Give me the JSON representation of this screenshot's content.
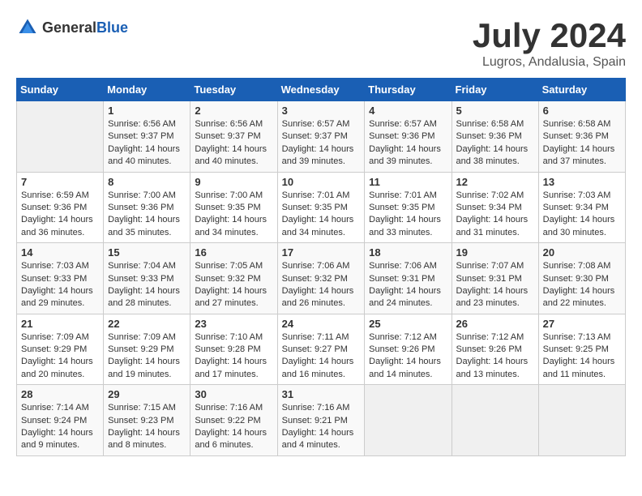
{
  "header": {
    "logo_general": "General",
    "logo_blue": "Blue",
    "month": "July 2024",
    "location": "Lugros, Andalusia, Spain"
  },
  "days_of_week": [
    "Sunday",
    "Monday",
    "Tuesday",
    "Wednesday",
    "Thursday",
    "Friday",
    "Saturday"
  ],
  "weeks": [
    [
      {
        "day": "",
        "empty": true
      },
      {
        "day": "1",
        "sunrise": "Sunrise: 6:56 AM",
        "sunset": "Sunset: 9:37 PM",
        "daylight": "Daylight: 14 hours and 40 minutes."
      },
      {
        "day": "2",
        "sunrise": "Sunrise: 6:56 AM",
        "sunset": "Sunset: 9:37 PM",
        "daylight": "Daylight: 14 hours and 40 minutes."
      },
      {
        "day": "3",
        "sunrise": "Sunrise: 6:57 AM",
        "sunset": "Sunset: 9:37 PM",
        "daylight": "Daylight: 14 hours and 39 minutes."
      },
      {
        "day": "4",
        "sunrise": "Sunrise: 6:57 AM",
        "sunset": "Sunset: 9:36 PM",
        "daylight": "Daylight: 14 hours and 39 minutes."
      },
      {
        "day": "5",
        "sunrise": "Sunrise: 6:58 AM",
        "sunset": "Sunset: 9:36 PM",
        "daylight": "Daylight: 14 hours and 38 minutes."
      },
      {
        "day": "6",
        "sunrise": "Sunrise: 6:58 AM",
        "sunset": "Sunset: 9:36 PM",
        "daylight": "Daylight: 14 hours and 37 minutes."
      }
    ],
    [
      {
        "day": "7",
        "sunrise": "Sunrise: 6:59 AM",
        "sunset": "Sunset: 9:36 PM",
        "daylight": "Daylight: 14 hours and 36 minutes."
      },
      {
        "day": "8",
        "sunrise": "Sunrise: 7:00 AM",
        "sunset": "Sunset: 9:36 PM",
        "daylight": "Daylight: 14 hours and 35 minutes."
      },
      {
        "day": "9",
        "sunrise": "Sunrise: 7:00 AM",
        "sunset": "Sunset: 9:35 PM",
        "daylight": "Daylight: 14 hours and 34 minutes."
      },
      {
        "day": "10",
        "sunrise": "Sunrise: 7:01 AM",
        "sunset": "Sunset: 9:35 PM",
        "daylight": "Daylight: 14 hours and 34 minutes."
      },
      {
        "day": "11",
        "sunrise": "Sunrise: 7:01 AM",
        "sunset": "Sunset: 9:35 PM",
        "daylight": "Daylight: 14 hours and 33 minutes."
      },
      {
        "day": "12",
        "sunrise": "Sunrise: 7:02 AM",
        "sunset": "Sunset: 9:34 PM",
        "daylight": "Daylight: 14 hours and 31 minutes."
      },
      {
        "day": "13",
        "sunrise": "Sunrise: 7:03 AM",
        "sunset": "Sunset: 9:34 PM",
        "daylight": "Daylight: 14 hours and 30 minutes."
      }
    ],
    [
      {
        "day": "14",
        "sunrise": "Sunrise: 7:03 AM",
        "sunset": "Sunset: 9:33 PM",
        "daylight": "Daylight: 14 hours and 29 minutes."
      },
      {
        "day": "15",
        "sunrise": "Sunrise: 7:04 AM",
        "sunset": "Sunset: 9:33 PM",
        "daylight": "Daylight: 14 hours and 28 minutes."
      },
      {
        "day": "16",
        "sunrise": "Sunrise: 7:05 AM",
        "sunset": "Sunset: 9:32 PM",
        "daylight": "Daylight: 14 hours and 27 minutes."
      },
      {
        "day": "17",
        "sunrise": "Sunrise: 7:06 AM",
        "sunset": "Sunset: 9:32 PM",
        "daylight": "Daylight: 14 hours and 26 minutes."
      },
      {
        "day": "18",
        "sunrise": "Sunrise: 7:06 AM",
        "sunset": "Sunset: 9:31 PM",
        "daylight": "Daylight: 14 hours and 24 minutes."
      },
      {
        "day": "19",
        "sunrise": "Sunrise: 7:07 AM",
        "sunset": "Sunset: 9:31 PM",
        "daylight": "Daylight: 14 hours and 23 minutes."
      },
      {
        "day": "20",
        "sunrise": "Sunrise: 7:08 AM",
        "sunset": "Sunset: 9:30 PM",
        "daylight": "Daylight: 14 hours and 22 minutes."
      }
    ],
    [
      {
        "day": "21",
        "sunrise": "Sunrise: 7:09 AM",
        "sunset": "Sunset: 9:29 PM",
        "daylight": "Daylight: 14 hours and 20 minutes."
      },
      {
        "day": "22",
        "sunrise": "Sunrise: 7:09 AM",
        "sunset": "Sunset: 9:29 PM",
        "daylight": "Daylight: 14 hours and 19 minutes."
      },
      {
        "day": "23",
        "sunrise": "Sunrise: 7:10 AM",
        "sunset": "Sunset: 9:28 PM",
        "daylight": "Daylight: 14 hours and 17 minutes."
      },
      {
        "day": "24",
        "sunrise": "Sunrise: 7:11 AM",
        "sunset": "Sunset: 9:27 PM",
        "daylight": "Daylight: 14 hours and 16 minutes."
      },
      {
        "day": "25",
        "sunrise": "Sunrise: 7:12 AM",
        "sunset": "Sunset: 9:26 PM",
        "daylight": "Daylight: 14 hours and 14 minutes."
      },
      {
        "day": "26",
        "sunrise": "Sunrise: 7:12 AM",
        "sunset": "Sunset: 9:26 PM",
        "daylight": "Daylight: 14 hours and 13 minutes."
      },
      {
        "day": "27",
        "sunrise": "Sunrise: 7:13 AM",
        "sunset": "Sunset: 9:25 PM",
        "daylight": "Daylight: 14 hours and 11 minutes."
      }
    ],
    [
      {
        "day": "28",
        "sunrise": "Sunrise: 7:14 AM",
        "sunset": "Sunset: 9:24 PM",
        "daylight": "Daylight: 14 hours and 9 minutes."
      },
      {
        "day": "29",
        "sunrise": "Sunrise: 7:15 AM",
        "sunset": "Sunset: 9:23 PM",
        "daylight": "Daylight: 14 hours and 8 minutes."
      },
      {
        "day": "30",
        "sunrise": "Sunrise: 7:16 AM",
        "sunset": "Sunset: 9:22 PM",
        "daylight": "Daylight: 14 hours and 6 minutes."
      },
      {
        "day": "31",
        "sunrise": "Sunrise: 7:16 AM",
        "sunset": "Sunset: 9:21 PM",
        "daylight": "Daylight: 14 hours and 4 minutes."
      },
      {
        "day": "",
        "empty": true
      },
      {
        "day": "",
        "empty": true
      },
      {
        "day": "",
        "empty": true
      }
    ]
  ]
}
